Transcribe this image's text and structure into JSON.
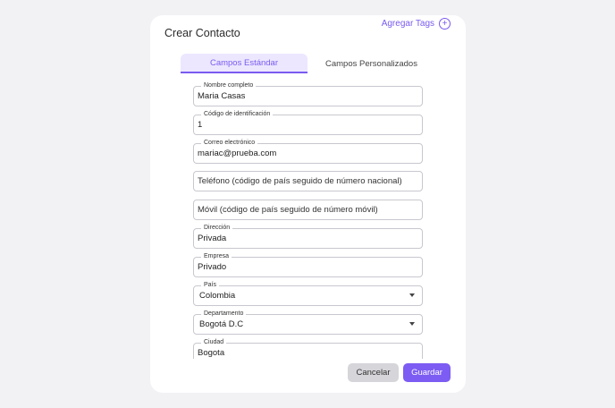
{
  "dialog": {
    "title": "Crear Contacto",
    "add_tags_label": "Agregar Tags"
  },
  "tabs": [
    {
      "label": "Campos Estándar",
      "active": true
    },
    {
      "label": "Campos Personalizados",
      "active": false
    }
  ],
  "fields": {
    "full_name": {
      "label": "Nombre completo",
      "value": "Maria Casas"
    },
    "id_code": {
      "label": "Código de identificación",
      "value": "1"
    },
    "email": {
      "label": "Correo electrónico",
      "value": "mariac@prueba.com"
    },
    "phone": {
      "placeholder": "Teléfono (código de país seguido de número nacional)"
    },
    "mobile": {
      "placeholder": "Móvil (código de país seguido de número móvil)"
    },
    "address": {
      "label": "Dirección",
      "value": "Privada"
    },
    "company": {
      "label": "Empresa",
      "value": "Privado"
    },
    "country": {
      "label": "País",
      "value": "Colombia"
    },
    "department": {
      "label": "Departamento",
      "value": "Bogotá D.C"
    },
    "city": {
      "label": "Ciudad",
      "value": "Bogota"
    }
  },
  "actions": {
    "cancel_label": "Cancelar",
    "save_label": "Guardar"
  },
  "colors": {
    "accent": "#7a5af0",
    "tab_active_bg": "#ece7ff",
    "cancel_bg": "#d6d5da"
  },
  "icons": {
    "add_tags": "plus-circle-icon",
    "select_caret": "caret-down-icon"
  }
}
